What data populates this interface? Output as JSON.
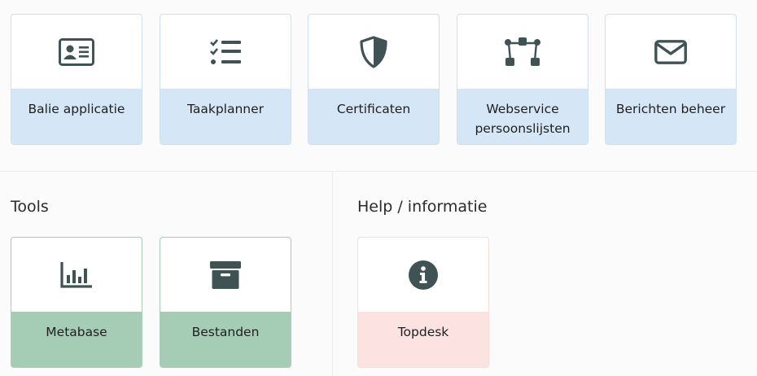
{
  "apps": [
    {
      "label": "Balie applicatie",
      "icon": "id-card-icon"
    },
    {
      "label": "Taakplanner",
      "icon": "task-list-icon"
    },
    {
      "label": "Certificaten",
      "icon": "shield-icon"
    },
    {
      "label": "Webservice persoonslijsten",
      "icon": "network-nodes-icon"
    },
    {
      "label": "Berichten beheer",
      "icon": "envelope-icon"
    }
  ],
  "tools": {
    "title": "Tools",
    "items": [
      {
        "label": "Metabase",
        "icon": "bar-chart-icon"
      },
      {
        "label": "Bestanden",
        "icon": "archive-box-icon"
      }
    ]
  },
  "help": {
    "title": "Help / informatie",
    "items": [
      {
        "label": "Topdesk",
        "icon": "info-circle-icon"
      }
    ]
  },
  "colors": {
    "icon": "#3f5355",
    "blue_label_bg": "#d5e6f6",
    "green_label_bg": "#a5cdb6",
    "pink_label_bg": "#fde2e2"
  }
}
